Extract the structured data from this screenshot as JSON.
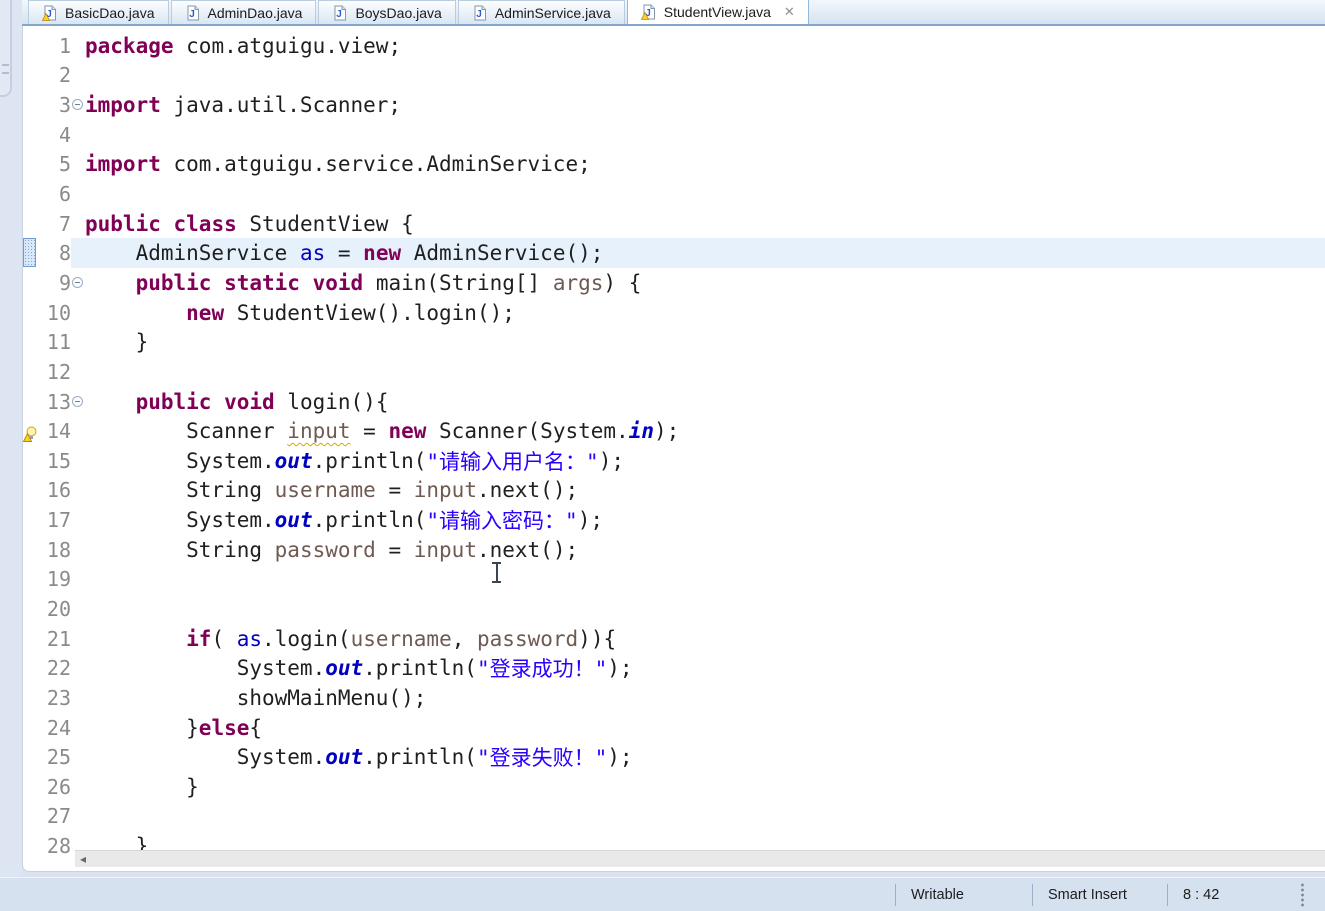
{
  "tabs": [
    {
      "label": "BasicDao.java",
      "icon": "java-file-warning-icon",
      "warning": true,
      "active": false
    },
    {
      "label": "AdminDao.java",
      "icon": "java-file-icon",
      "warning": false,
      "active": false
    },
    {
      "label": "BoysDao.java",
      "icon": "java-file-icon",
      "warning": false,
      "active": false
    },
    {
      "label": "AdminService.java",
      "icon": "java-file-icon",
      "warning": false,
      "active": false
    },
    {
      "label": "StudentView.java",
      "icon": "java-file-warning-icon",
      "warning": true,
      "active": true,
      "close_label": "✕"
    }
  ],
  "editor": {
    "language": "java",
    "lines": [
      {
        "n": 1,
        "fold": false,
        "marker": null,
        "hl": false,
        "segs": [
          [
            "kw",
            "package"
          ],
          [
            "pl",
            " com.atguigu.view;"
          ]
        ]
      },
      {
        "n": 2,
        "fold": false,
        "marker": null,
        "hl": false,
        "segs": []
      },
      {
        "n": 3,
        "fold": true,
        "marker": null,
        "hl": false,
        "segs": [
          [
            "kw",
            "import"
          ],
          [
            "pl",
            " java.util.Scanner;"
          ]
        ]
      },
      {
        "n": 4,
        "fold": false,
        "marker": null,
        "hl": false,
        "segs": []
      },
      {
        "n": 5,
        "fold": false,
        "marker": null,
        "hl": false,
        "segs": [
          [
            "kw",
            "import"
          ],
          [
            "pl",
            " com.atguigu.service.AdminService;"
          ]
        ]
      },
      {
        "n": 6,
        "fold": false,
        "marker": null,
        "hl": false,
        "segs": []
      },
      {
        "n": 7,
        "fold": false,
        "marker": null,
        "hl": false,
        "segs": [
          [
            "kw",
            "public"
          ],
          [
            "pl",
            " "
          ],
          [
            "kw",
            "class"
          ],
          [
            "pl",
            " StudentView {"
          ]
        ]
      },
      {
        "n": 8,
        "fold": false,
        "marker": "occurrence",
        "hl": true,
        "segs": [
          [
            "pl",
            "    AdminService "
          ],
          [
            "fd",
            "as"
          ],
          [
            "pl",
            " = "
          ],
          [
            "kw",
            "new"
          ],
          [
            "pl",
            " AdminService();"
          ]
        ]
      },
      {
        "n": 9,
        "fold": true,
        "marker": null,
        "hl": false,
        "segs": [
          [
            "pl",
            "    "
          ],
          [
            "kw",
            "public"
          ],
          [
            "pl",
            " "
          ],
          [
            "kw",
            "static"
          ],
          [
            "pl",
            " "
          ],
          [
            "kw",
            "void"
          ],
          [
            "pl",
            " main(String[] "
          ],
          [
            "lv",
            "args"
          ],
          [
            "pl",
            ") {"
          ]
        ]
      },
      {
        "n": 10,
        "fold": false,
        "marker": null,
        "hl": false,
        "segs": [
          [
            "pl",
            "        "
          ],
          [
            "kw",
            "new"
          ],
          [
            "pl",
            " StudentView().login();"
          ]
        ]
      },
      {
        "n": 11,
        "fold": false,
        "marker": null,
        "hl": false,
        "segs": [
          [
            "pl",
            "    }"
          ]
        ]
      },
      {
        "n": 12,
        "fold": false,
        "marker": null,
        "hl": false,
        "segs": []
      },
      {
        "n": 13,
        "fold": true,
        "marker": null,
        "hl": false,
        "segs": [
          [
            "pl",
            "    "
          ],
          [
            "kw",
            "public"
          ],
          [
            "pl",
            " "
          ],
          [
            "kw",
            "void"
          ],
          [
            "pl",
            " login(){"
          ]
        ]
      },
      {
        "n": 14,
        "fold": false,
        "marker": "bulb",
        "hl": false,
        "segs": [
          [
            "pl",
            "        Scanner "
          ],
          [
            "lvw",
            "input"
          ],
          [
            "pl",
            " = "
          ],
          [
            "kw",
            "new"
          ],
          [
            "pl",
            " Scanner(System."
          ],
          [
            "sf",
            "in"
          ],
          [
            "pl",
            ");"
          ]
        ]
      },
      {
        "n": 15,
        "fold": false,
        "marker": null,
        "hl": false,
        "segs": [
          [
            "pl",
            "        System."
          ],
          [
            "sf",
            "out"
          ],
          [
            "pl",
            ".println("
          ],
          [
            "st",
            "\"请输入用户名：\""
          ],
          [
            "pl",
            ");"
          ]
        ]
      },
      {
        "n": 16,
        "fold": false,
        "marker": null,
        "hl": false,
        "segs": [
          [
            "pl",
            "        String "
          ],
          [
            "lv",
            "username"
          ],
          [
            "pl",
            " = "
          ],
          [
            "lv",
            "input"
          ],
          [
            "pl",
            ".next();"
          ]
        ]
      },
      {
        "n": 17,
        "fold": false,
        "marker": null,
        "hl": false,
        "segs": [
          [
            "pl",
            "        System."
          ],
          [
            "sf",
            "out"
          ],
          [
            "pl",
            ".println("
          ],
          [
            "st",
            "\"请输入密码：\""
          ],
          [
            "pl",
            ");"
          ]
        ]
      },
      {
        "n": 18,
        "fold": false,
        "marker": null,
        "hl": false,
        "segs": [
          [
            "pl",
            "        String "
          ],
          [
            "lv",
            "password"
          ],
          [
            "pl",
            " = "
          ],
          [
            "lv",
            "input"
          ],
          [
            "pl",
            ".next();"
          ]
        ]
      },
      {
        "n": 19,
        "fold": false,
        "marker": null,
        "hl": false,
        "segs": []
      },
      {
        "n": 20,
        "fold": false,
        "marker": null,
        "hl": false,
        "segs": []
      },
      {
        "n": 21,
        "fold": false,
        "marker": null,
        "hl": false,
        "segs": [
          [
            "pl",
            "        "
          ],
          [
            "kw",
            "if"
          ],
          [
            "pl",
            "( "
          ],
          [
            "fd",
            "as"
          ],
          [
            "pl",
            ".login("
          ],
          [
            "lv",
            "username"
          ],
          [
            "pl",
            ", "
          ],
          [
            "lv",
            "password"
          ],
          [
            "pl",
            ")){"
          ]
        ]
      },
      {
        "n": 22,
        "fold": false,
        "marker": null,
        "hl": false,
        "segs": [
          [
            "pl",
            "            System."
          ],
          [
            "sf",
            "out"
          ],
          [
            "pl",
            ".println("
          ],
          [
            "st",
            "\"登录成功！\""
          ],
          [
            "pl",
            ");"
          ]
        ]
      },
      {
        "n": 23,
        "fold": false,
        "marker": null,
        "hl": false,
        "segs": [
          [
            "pl",
            "            showMainMenu();"
          ]
        ]
      },
      {
        "n": 24,
        "fold": false,
        "marker": null,
        "hl": false,
        "segs": [
          [
            "pl",
            "        }"
          ],
          [
            "kw",
            "else"
          ],
          [
            "pl",
            "{"
          ]
        ]
      },
      {
        "n": 25,
        "fold": false,
        "marker": null,
        "hl": false,
        "segs": [
          [
            "pl",
            "            System."
          ],
          [
            "sf",
            "out"
          ],
          [
            "pl",
            ".println("
          ],
          [
            "st",
            "\"登录失败！\""
          ],
          [
            "pl",
            ");"
          ]
        ]
      },
      {
        "n": 26,
        "fold": false,
        "marker": null,
        "hl": false,
        "segs": [
          [
            "pl",
            "        }"
          ]
        ]
      },
      {
        "n": 27,
        "fold": false,
        "marker": null,
        "hl": false,
        "segs": []
      },
      {
        "n": 28,
        "fold": false,
        "marker": null,
        "hl": false,
        "segs": [
          [
            "pl",
            "    }"
          ]
        ]
      }
    ]
  },
  "scrollbar": {
    "left_arrow": "◂"
  },
  "statusbar": {
    "writable": "Writable",
    "insert_mode": "Smart Insert",
    "position": "8 : 42"
  },
  "colors": {
    "keyword": "#7f0055",
    "string": "#2a00ff",
    "field": "#0000c0",
    "static_field": "#0000c0",
    "local_variable": "#6f5a52",
    "line_highlight": "#e6f1fc",
    "tab_bar_border": "#83a7cb",
    "status_bg": "#d6e1f0",
    "warning_yellow": "#ffd21e"
  }
}
